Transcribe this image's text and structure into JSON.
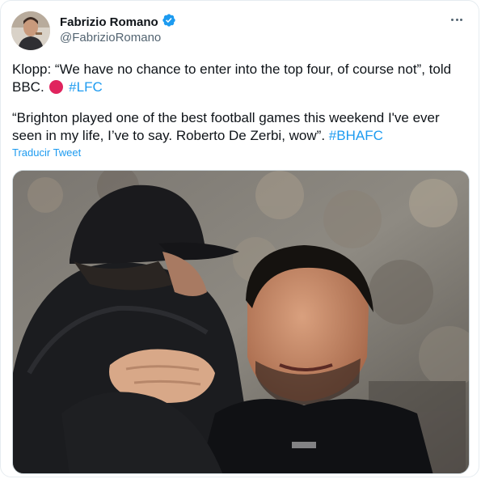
{
  "author": {
    "display_name": "Fabrizio Romano",
    "handle": "@FabrizioRomano",
    "verified": true
  },
  "tweet": {
    "line1_text": "Klopp: “We have no chance to enter into the top four, of course not”, told BBC.",
    "line1_hashtag": "#LFC",
    "line2_text": "“Brighton played one of the best football games this weekend I've ever seen in my life, I’ve to say. Roberto De Zerbi, wow”.",
    "line2_hashtag": "#BHAFC",
    "translate_label": "Traducir Tweet"
  },
  "colors": {
    "accent": "#1d9bf0",
    "secondary_text": "#536471",
    "red_circle": "#e0245e"
  },
  "icons": [
    "verified-badge-icon",
    "more-options-icon",
    "red-circle-emoji-icon"
  ]
}
